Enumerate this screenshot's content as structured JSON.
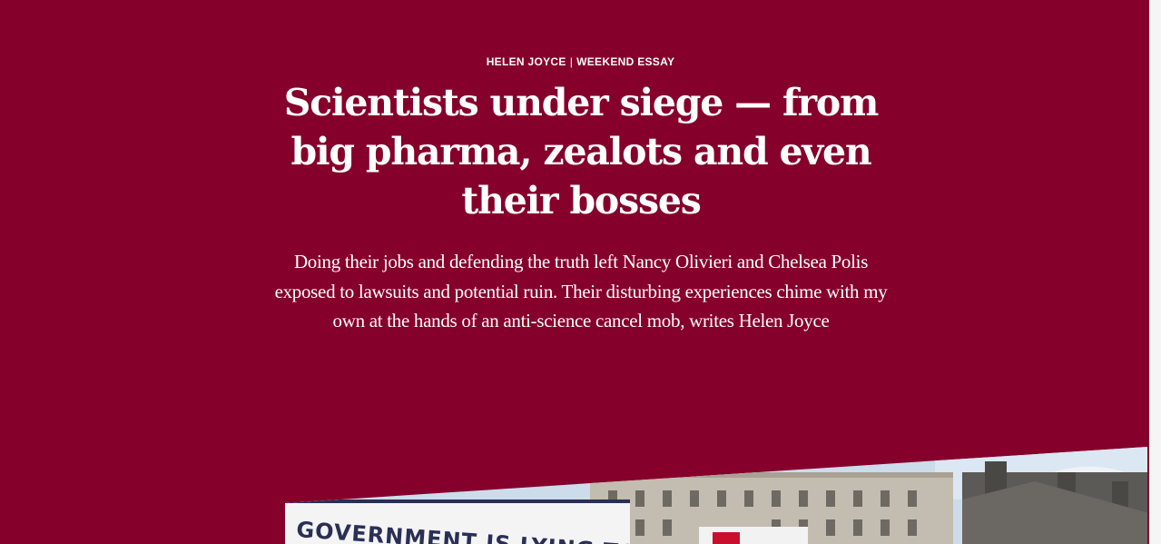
{
  "article": {
    "author": "HELEN JOYCE",
    "section": "WEEKEND ESSAY",
    "separator": "|",
    "headline": "Scientists under siege — from big pharma, zealots and even their bosses",
    "standfirst": "Doing their jobs and defending the truth left Nancy Olivieri and Chelsea Polis exposed to lawsuits and potential ruin. Their disturbing experiences chime with my own at the hands of an anti-science cancel mob, writes Helen Joyce"
  },
  "hero_image": {
    "banner_text": "GOVERNMENT IS LYING TO YOU"
  },
  "colors": {
    "background": "#85002b",
    "text": "#ffffff",
    "sky": "#cfe0ee",
    "stone": "#bdb6aa"
  }
}
